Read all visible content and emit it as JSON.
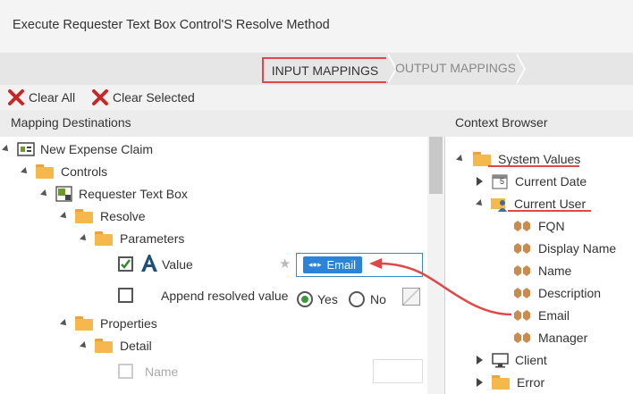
{
  "title": "Execute Requester Text Box Control'S Resolve Method",
  "wizard": {
    "steps": [
      "INPUT MAPPINGS",
      "OUTPUT MAPPINGS"
    ]
  },
  "toolbar": {
    "clear_all": "Clear All",
    "clear_selected": "Clear Selected"
  },
  "left_pane": {
    "header": "Mapping Destinations",
    "tree": {
      "root": "New Expense Claim",
      "controls": "Controls",
      "requester": "Requester Text Box",
      "resolve": "Resolve",
      "parameters": "Parameters",
      "value_label": "Value",
      "append_label": "Append resolved value",
      "yes": "Yes",
      "no": "No",
      "properties": "Properties",
      "detail": "Detail",
      "name": "Name"
    },
    "value_token": "Email",
    "star": "★"
  },
  "right_pane": {
    "header": "Context Browser",
    "tree": {
      "system_values": "System Values",
      "current_date": "Current Date",
      "current_user": "Current User",
      "fields": [
        "FQN",
        "Display Name",
        "Name",
        "Description",
        "Email",
        "Manager"
      ],
      "client": "Client",
      "error": "Error"
    },
    "calendar_day": "5"
  },
  "colors": {
    "annotation_red": "#e04848",
    "token_blue": "#2c84d8",
    "folder": "#f5b84c",
    "field_icon": "#c98b4e",
    "radio_green": "#3a9a3a"
  }
}
